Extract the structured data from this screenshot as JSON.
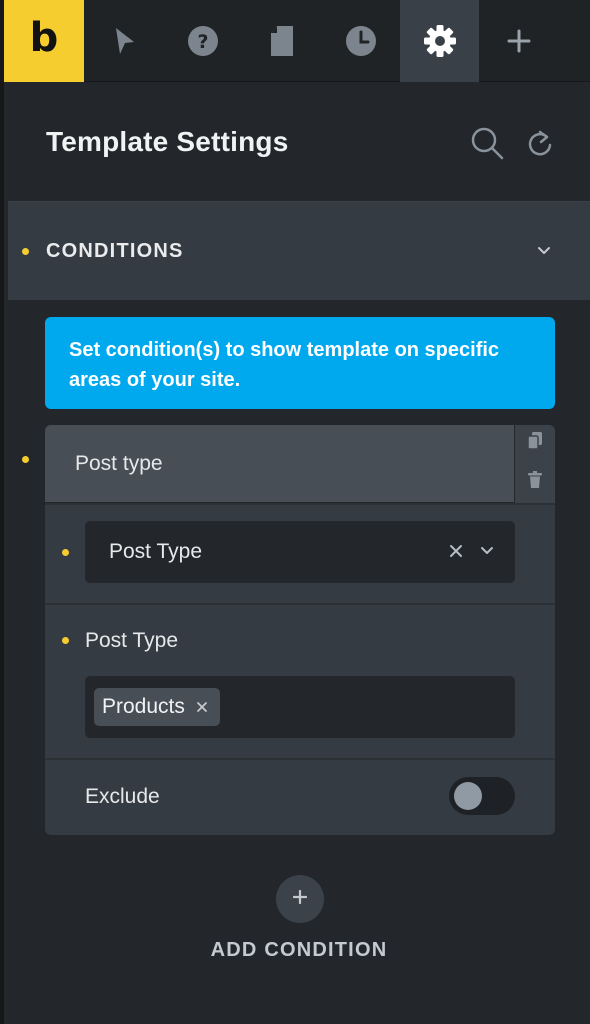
{
  "toolbar": {
    "logo": "b",
    "tools": [
      {
        "icon": "pointer-icon",
        "active": false
      },
      {
        "icon": "help-icon",
        "active": false
      },
      {
        "icon": "page-icon",
        "active": false
      },
      {
        "icon": "history-icon",
        "active": false
      },
      {
        "icon": "gear-icon",
        "active": true
      },
      {
        "icon": "plus-icon",
        "active": false
      }
    ]
  },
  "header": {
    "title": "Template Settings",
    "icons": [
      "search-icon",
      "refresh-icon"
    ]
  },
  "section": {
    "title": "CONDITIONS",
    "icon": "chevron-down-icon"
  },
  "info": {
    "text": "Set condition(s) to show template on specific areas of your site."
  },
  "condition": {
    "header_label": "Post type",
    "actions": [
      "duplicate-icon",
      "trash-icon"
    ],
    "select": {
      "value": "Post Type"
    },
    "post_type_field": {
      "label": "Post Type",
      "tags": [
        "Products"
      ]
    },
    "exclude": {
      "label": "Exclude",
      "enabled": false
    }
  },
  "add_condition": {
    "label": "ADD CONDITION"
  },
  "colors": {
    "accent": "#f5cd2f",
    "info": "#00a8ee",
    "panel": "#23272b",
    "card": "#353b42"
  }
}
